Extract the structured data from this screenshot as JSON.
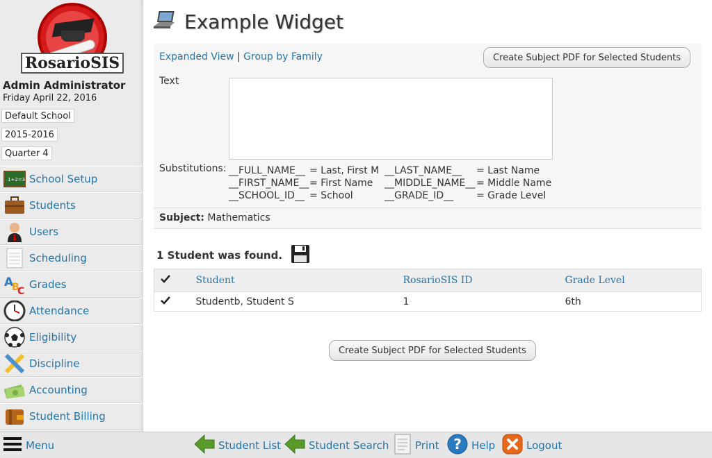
{
  "app": {
    "logo_text": "RosarioSIS"
  },
  "user": {
    "name": "Admin Administrator",
    "date": "Friday April 22, 2016"
  },
  "selectors": {
    "school": "Default School",
    "year": "2015-2016",
    "quarter": "Quarter 4"
  },
  "sidebar": {
    "items": [
      {
        "label": "School Setup",
        "icon": "chalkboard-icon"
      },
      {
        "label": "Students",
        "icon": "briefcase-icon"
      },
      {
        "label": "Users",
        "icon": "user-icon"
      },
      {
        "label": "Scheduling",
        "icon": "notepad-icon"
      },
      {
        "label": "Grades",
        "icon": "abc-icon"
      },
      {
        "label": "Attendance",
        "icon": "clock-icon"
      },
      {
        "label": "Eligibility",
        "icon": "soccer-ball-icon"
      },
      {
        "label": "Discipline",
        "icon": "pencil-ruler-icon"
      },
      {
        "label": "Accounting",
        "icon": "money-icon"
      },
      {
        "label": "Student Billing",
        "icon": "wallet-icon"
      }
    ]
  },
  "page": {
    "title": "Example Widget",
    "icon": "laptop-icon"
  },
  "header": {
    "expanded_view": "Expanded View",
    "separator": "|",
    "group_by_family": "Group by Family",
    "create_pdf": "Create Subject PDF for Selected Students"
  },
  "form": {
    "text_label": "Text",
    "text_value": "",
    "substitutions_label": "Substitutions:",
    "substitutions": [
      {
        "code": "__FULL_NAME__",
        "meaning": "= Last, First M"
      },
      {
        "code": "__LAST_NAME__",
        "meaning": "= Last Name"
      },
      {
        "code": "__FIRST_NAME__",
        "meaning": "= First Name"
      },
      {
        "code": "__MIDDLE_NAME__",
        "meaning": "= Middle Name"
      },
      {
        "code": "__SCHOOL_ID__",
        "meaning": "= School"
      },
      {
        "code": "__GRADE_ID__",
        "meaning": "= Grade Level"
      }
    ],
    "subject_label": "Subject:",
    "subject_value": "Mathematics"
  },
  "results": {
    "found_text": "1 Student was found.",
    "columns": [
      "Student",
      "RosarioSIS ID",
      "Grade Level"
    ],
    "rows": [
      {
        "student": "Studentb, Student S",
        "id": "1",
        "grade": "6th"
      }
    ],
    "create_pdf": "Create Subject PDF for Selected Students"
  },
  "bottombar": {
    "menu": "Menu",
    "student_list": "Student List",
    "student_search": "Student Search",
    "print": "Print",
    "help": "Help",
    "logout": "Logout"
  },
  "colors": {
    "link": "#2374a8",
    "logo_red": "#d41a1a",
    "arrow_green": "#5a9a2a",
    "logout_orange": "#e8681a",
    "help_blue": "#2a7ac0"
  }
}
